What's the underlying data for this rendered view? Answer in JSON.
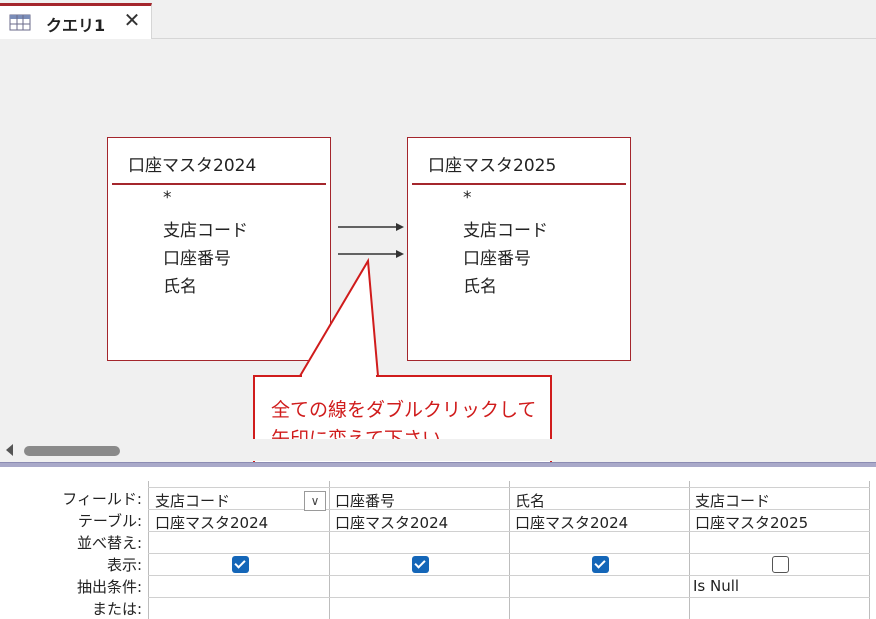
{
  "tab": {
    "title": "クエリ1",
    "close_glyph": "✕",
    "icon": "query-grid-icon"
  },
  "tables": [
    {
      "title": "口座マスタ2024",
      "fields": [
        "*",
        "支店コード",
        "口座番号",
        "氏名"
      ]
    },
    {
      "title": "口座マスタ2025",
      "fields": [
        "*",
        "支店コード",
        "口座番号",
        "氏名"
      ]
    }
  ],
  "callout": {
    "lines": [
      "全ての線をダブルクリックして",
      "矢印に変えて下さい"
    ],
    "color": "#d01c1c"
  },
  "grid": {
    "row_labels": [
      "フィールド:",
      "テーブル:",
      "並べ替え:",
      "表示:",
      "抽出条件:",
      "または:"
    ],
    "dropdown_glyph": "∨",
    "columns": [
      {
        "field": "支店コード",
        "table": "口座マスタ2024",
        "sort": "",
        "show": true,
        "criteria": "",
        "or": ""
      },
      {
        "field": "口座番号",
        "table": "口座マスタ2024",
        "sort": "",
        "show": true,
        "criteria": "",
        "or": ""
      },
      {
        "field": "氏名",
        "table": "口座マスタ2024",
        "sort": "",
        "show": true,
        "criteria": "",
        "or": ""
      },
      {
        "field": "支店コード",
        "table": "口座マスタ2025",
        "sort": "",
        "show": false,
        "criteria": "Is Null",
        "or": ""
      }
    ]
  },
  "colors": {
    "accent": "#a4262c",
    "checkbox": "#1466b8",
    "callout": "#d01c1c"
  }
}
